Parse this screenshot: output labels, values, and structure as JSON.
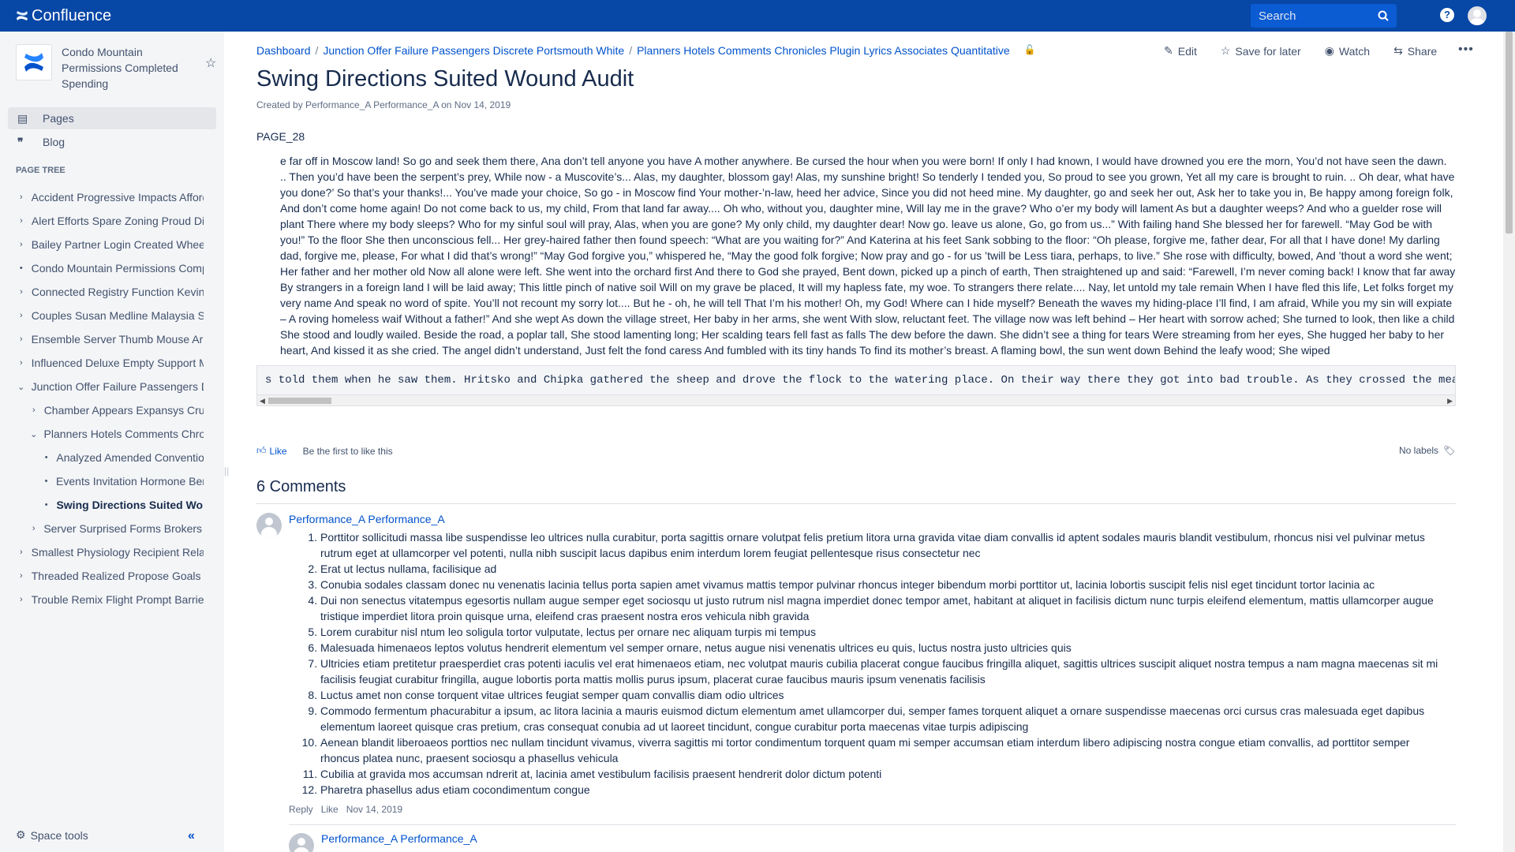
{
  "app": {
    "name": "Confluence",
    "search_placeholder": "Search"
  },
  "sidebar": {
    "space_name": "Condo Mountain Permissions Completed Spending",
    "nav": [
      {
        "label": "Pages",
        "icon": "page-icon"
      },
      {
        "label": "Blog",
        "icon": "quote-icon"
      }
    ],
    "tree_title": "PAGE TREE",
    "tree": [
      {
        "label": "Accident Progressive Impacts Afford",
        "level": 0,
        "chev": "›"
      },
      {
        "label": "Alert Efforts Spare Zoning Proud Di",
        "level": 0,
        "chev": "›"
      },
      {
        "label": "Bailey Partner Login Created Wheel",
        "level": 0,
        "chev": "›"
      },
      {
        "label": "Condo Mountain Permissions Comp",
        "level": 0,
        "chev": "•"
      },
      {
        "label": "Connected Registry Function Kevin",
        "level": 0,
        "chev": "›"
      },
      {
        "label": "Couples Susan Medline Malaysia Sl",
        "level": 0,
        "chev": "›"
      },
      {
        "label": "Ensemble Server Thumb Mouse Ark",
        "level": 0,
        "chev": "›"
      },
      {
        "label": "Influenced Deluxe Empty Support M",
        "level": 0,
        "chev": "›"
      },
      {
        "label": "Junction Offer Failure Passengers D",
        "level": 0,
        "chev": "⌄"
      },
      {
        "label": "Chamber Appears Expansys Crui",
        "level": 1,
        "chev": "›"
      },
      {
        "label": "Planners Hotels Comments Chror",
        "level": 1,
        "chev": "⌄"
      },
      {
        "label": "Analyzed Amended Convention",
        "level": 2,
        "chev": "•"
      },
      {
        "label": "Events Invitation Hormone Bene",
        "level": 2,
        "chev": "•"
      },
      {
        "label": "Swing Directions Suited Wou",
        "level": 2,
        "chev": "•",
        "current": true
      },
      {
        "label": "Server Surprised Forms Brokers F",
        "level": 1,
        "chev": "›"
      },
      {
        "label": "Smallest Physiology Recipient Relat",
        "level": 0,
        "chev": "›"
      },
      {
        "label": "Threaded Realized Propose Goals I",
        "level": 0,
        "chev": "›"
      },
      {
        "label": "Trouble Remix Flight Prompt Barrier",
        "level": 0,
        "chev": "›"
      }
    ],
    "space_tools": "Space tools"
  },
  "breadcrumbs": [
    "Dashboard",
    "Junction Offer Failure Passengers Discrete Portsmouth White",
    "Planners Hotels Comments Chronicles Plugin Lyrics Associates Quantitative"
  ],
  "actions": {
    "edit": "Edit",
    "save": "Save for later",
    "watch": "Watch",
    "share": "Share"
  },
  "page": {
    "title": "Swing Directions Suited Wound Audit",
    "byline": "Created by Performance_A Performance_A on Nov 14, 2019",
    "page_id": "PAGE_28",
    "poem": "e far off in Moscow land! So go and seek them there, Ana don’t tell anyone you have A mother anywhere. Be cursed the hour when you were born! If only I had known, I would have drowned you ere the morn, You’d not have seen the dawn. .. Then you’d have been the serpent’s prey, While now - a Muscovite’s... Alas, my daughter, blossom gay! Alas, my sunshine bright! So tenderly I tended you, So proud to see you grown, Yet all my care is brought to ruin. .. Oh dear, what have you done?’ So that’s your thanks!... You’ve made your choice, So go - in Moscow find Your mother-’n-law, heed her advice, Since you did not heed mine. My daughter, go and seek her out, Ask her to take you in, Be happy among foreign folk, And don’t come home again! Do not come back to us, my child, From that land far away.... Oh who, without you, daughter mine, Will lay me in the grave? Who o’er my body will lament As but a daughter weeps? And who a guelder rose will plant There where my body sleeps? Who for my sinful soul will pray, Alas, when you are gone? My only child, my daughter dear! Now go. leave us alone, Go, go from us...” With failing hand She blessed her for farewell. “May God be with you!” To the floor She then unconscious fell... Her grey-haired father then found speech: “What are you waiting for?” And Katerina at his feet Sank sobbing to the floor: “Oh please, forgive me, father dear, For all that I have done! My darling dad, forgive me, please, For what I did that’s wrong!” “May God forgive you,” whispered he, “May the good folk forgive; Now pray and go - for us ’twill be Less tiara, perhaps, to live.” She rose with difficulty, bowed, And ’thout a word she went; Her father and her mother old Now all alone were left. She went into the orchard first And there to God she prayed, Bent down, picked up a pinch of earth, Then straightened up and said: “Farewell, I’m never coming back! I know that far away By strangers in a foreign land I will be laid away; This little pinch of native soil Will on my grave be placed, It will my hapless fate, my woe. To strangers there relate.... Nay, let untold my tale remain When I have fled this life, Let folks forget my very name And speak no word of spite. You’ll not recount my sorry lot.... But he - oh, he will tell That I’m his mother! Oh, my God! Where can I hide myself? Beneath the waves my hiding-place I’ll find, I am afraid, While you my sin will expiate – A roving homeless waif Without a father!” And she wept As down the village street, Her baby in her arms, she went With slow, reluctant feet. The village now was left behind – Her heart with sorrow ached; She turned to look, then like a child She stood and loudly wailed. Beside the road, a poplar tall, She stood lamenting long; Her scalding tears fell fast as falls The dew before the dawn. She didn’t see a thing for tears Were streaming from her eyes, She hugged her baby to her heart, And kissed it as she cried. The angel didn’t understand, Just felt the fond caress And fumbled with its tiny hands To find its mother’s breast. A flaming bowl, the sun went down Behind the leafy wood; She wiped",
    "code": "s told them when he saw them. Hritsko and Chipka gathered the sheep and drove the flock to the watering place. On their way there they got into bad trouble. As they crossed the meadow"
  },
  "like_bar": {
    "like": "Like",
    "first": "Be the first to like this",
    "labels": "No labels"
  },
  "comments": {
    "heading": "6 Comments",
    "first": {
      "author": "Performance_A Performance_A",
      "items": [
        "Porttitor sollicitudi massa libe suspendisse leo ultrices nulla curabitur, porta sagittis ornare volutpat felis pretium litora urna gravida vitae diam convallis id aptent sodales mauris blandit vestibulum, rhoncus nisi vel pulvinar metus rutrum eget at ullamcorper vel potenti, nulla nibh suscipit lacus dapibus enim interdum lorem feugiat pellentesque risus consectetur nec",
        "Erat ut lectus nullama, facilisique ad",
        "Conubia sodales classam donec nu venenatis lacinia tellus porta sapien amet vivamus mattis tempor pulvinar rhoncus integer bibendum morbi porttitor ut, lacinia lobortis suscipit felis nisl eget tincidunt tortor lacinia ac",
        "Dui non senectus vitatempus egesortis nullam augue semper eget sociosqu ut justo rutrum nisl magna imperdiet donec tempor amet, habitant at aliquet in facilisis dictum nunc turpis eleifend elementum, mattis ullamcorper augue tristique imperdiet litora proin quisque urna, eleifend cras praesent nostra eros vehicula nibh gravida",
        "Lorem curabitur nisl ntum leo soligula tortor vulputate, lectus per ornare nec aliquam turpis mi tempus",
        "Malesuada himenaeos leptos volutus hendrerit elementum vel semper ornare, netus augue nisi venenatis ultrices eu quis, luctus nostra justo ultricies quis",
        "Ultricies etiam pretitetur praesperdiet cras potenti iaculis vel erat himenaeos etiam, nec volutpat mauris cubilia placerat congue faucibus fringilla aliquet, sagittis ultrices suscipit aliquet nostra tempus a nam magna maecenas sit mi facilisis feugiat curabitur fringilla, augue lobortis porta mattis mollis purus ipsum, placerat curae faucibus mauris ipsum venenatis facilisis",
        "Luctus amet non conse torquent vitae ultrices feugiat semper quam convallis diam odio ultrices",
        "Commodo fermentum phacurabitur a ipsum, ac litora lacinia a mauris euismod dictum elementum amet ullamcorper dui, semper fames torquent aliquet a ornare suspendisse maecenas orci cursus cras malesuada eget dapibus elementum laoreet quisque cras pretium, cras consequat conubia ad ut laoreet tincidunt, congue curabitur porta maecenas vitae turpis adipiscing",
        "Aenean blandit liberoaeos porttios nec nullam tincidunt vivamus, viverra sagittis mi tortor condimentum torquent quam mi semper accumsan etiam interdum libero adipiscing nostra congue etiam convallis, ad porttitor semper rhoncus platea nunc, praesent sociosqu a phasellus vehicula",
        "Cubilia at gravida mos accumsan ndrerit at, lacinia amet vestibulum facilisis praesent hendrerit dolor dictum potenti",
        "Pharetra phasellus adus etiam cocondimentum congue"
      ],
      "reply": "Reply",
      "like": "Like",
      "date": "Nov 14, 2019"
    },
    "second": {
      "author": "Performance_A Performance_A"
    }
  }
}
